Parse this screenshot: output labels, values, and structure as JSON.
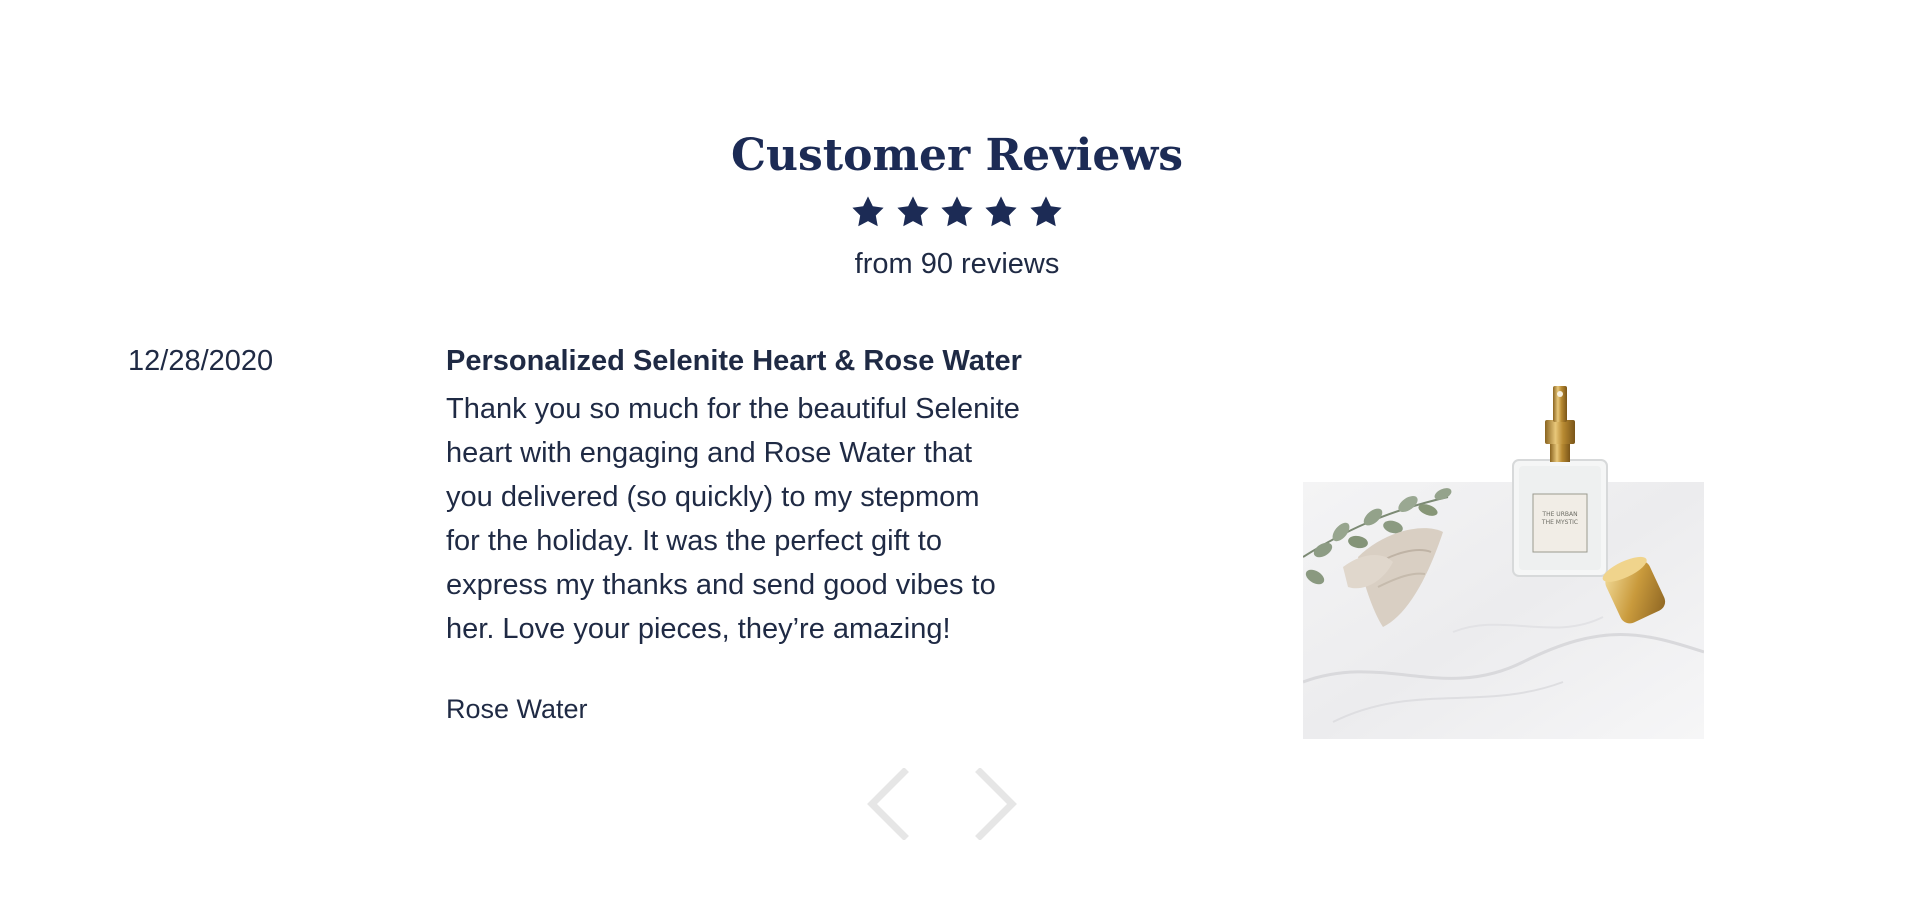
{
  "header": {
    "title": "Customer Reviews",
    "rating": 5,
    "rating_max": 5,
    "review_count_text": "from 90 reviews"
  },
  "review": {
    "date": "12/28/2020",
    "title": "Personalized Selenite Heart & Rose Water",
    "body_lines": [
      "Thank you so much for the beautiful Selenite",
      "heart with engaging and Rose Water that",
      "you delivered (so quickly) to my stepmom",
      "for the holiday. It was the perfect gift to",
      "express my thanks and send good vibes to",
      "her. Love your pieces, they’re amazing!"
    ],
    "product": "Rose Water",
    "photo_icon": "product-photo",
    "photo_label_lines": [
      "THE URBAN",
      "THE MYSTIC"
    ]
  },
  "carousel": {
    "prev_icon": "chevron-left-icon",
    "next_icon": "chevron-right-icon"
  },
  "colors": {
    "navy": "#1c2b55",
    "text": "#1f2a44",
    "arrow": "#e6e6e6",
    "gold": "#c9a24a"
  }
}
